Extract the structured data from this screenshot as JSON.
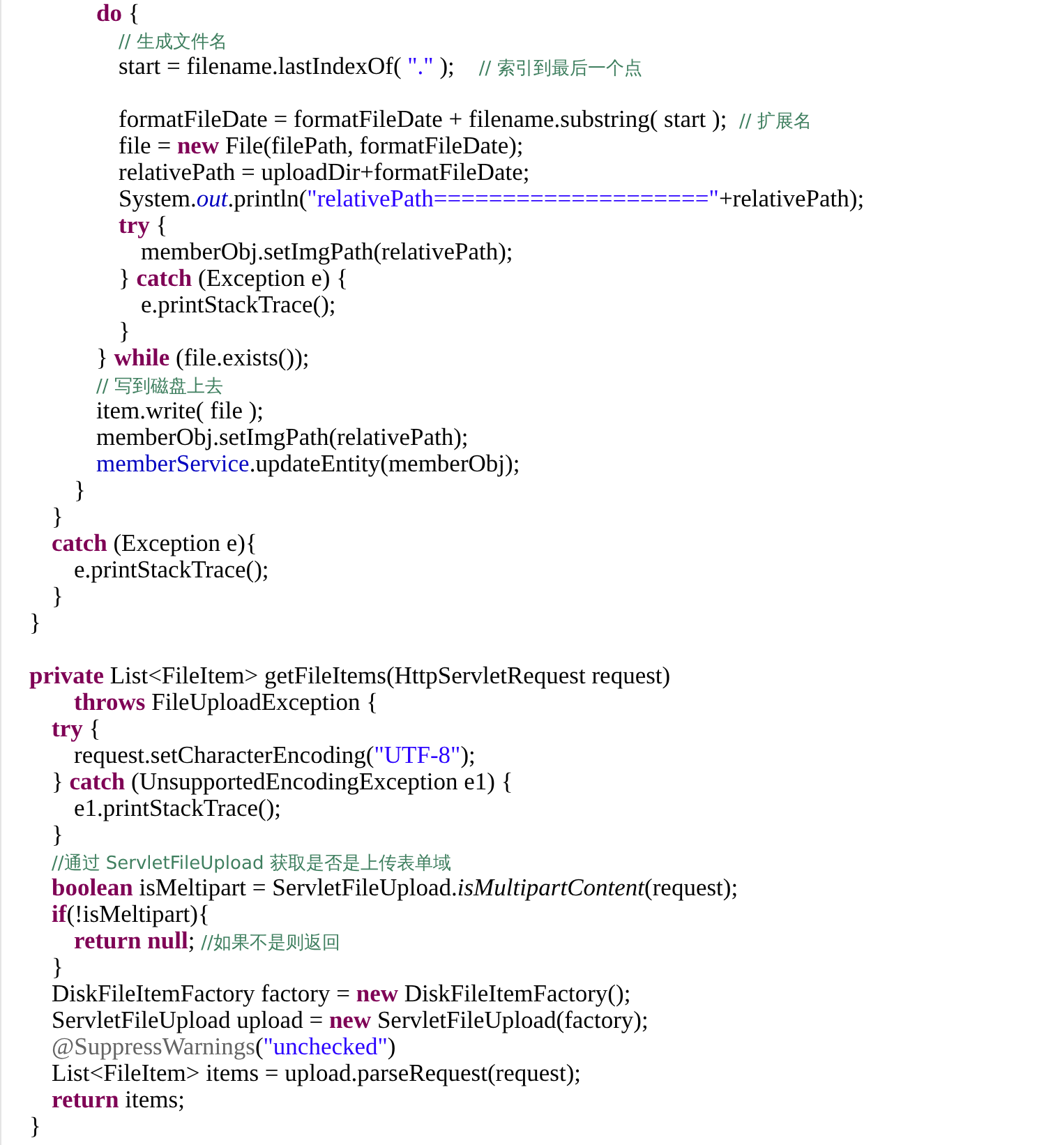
{
  "code_lines": [
    {
      "kind": "code",
      "segments": [
        {
          "kind": "keyword",
          "text": "\t\t\tdo"
        },
        {
          "kind": "plain",
          "text": " {"
        }
      ]
    },
    {
      "kind": "code",
      "segments": [
        {
          "kind": "comment",
          "text": "\t\t\t\t// 生成文件名"
        }
      ]
    },
    {
      "kind": "code",
      "segments": [
        {
          "kind": "plain",
          "text": "\t\t\t\tstart = filename.lastIndexOf( "
        },
        {
          "kind": "string",
          "text": "\".\""
        },
        {
          "kind": "plain",
          "text": " );    "
        },
        {
          "kind": "comment",
          "text": "// 索引到最后一个点"
        }
      ]
    },
    {
      "kind": "blank"
    },
    {
      "kind": "code",
      "segments": [
        {
          "kind": "plain",
          "text": "\t\t\t\tformatFileDate = formatFileDate + filename.substring( start );  "
        },
        {
          "kind": "comment",
          "text": "// 扩展名"
        }
      ]
    },
    {
      "kind": "code",
      "segments": [
        {
          "kind": "plain",
          "text": "\t\t\t\tfile = "
        },
        {
          "kind": "keyword",
          "text": "new"
        },
        {
          "kind": "plain",
          "text": " File(filePath, formatFileDate);"
        }
      ]
    },
    {
      "kind": "code",
      "segments": [
        {
          "kind": "plain",
          "text": "\t\t\t\trelativePath = uploadDir+formatFileDate;"
        }
      ]
    },
    {
      "kind": "code",
      "segments": [
        {
          "kind": "plain",
          "text": "\t\t\t\tSystem."
        },
        {
          "kind": "static_field",
          "text": "out"
        },
        {
          "kind": "plain",
          "text": ".println("
        },
        {
          "kind": "string",
          "text": "\"relativePath====================\""
        },
        {
          "kind": "plain",
          "text": "+relativePath);"
        }
      ]
    },
    {
      "kind": "code",
      "segments": [
        {
          "kind": "keyword",
          "text": "\t\t\t\ttry"
        },
        {
          "kind": "plain",
          "text": " {"
        }
      ]
    },
    {
      "kind": "code",
      "segments": [
        {
          "kind": "plain",
          "text": "\t\t\t\t\tmemberObj.setImgPath(relativePath);"
        }
      ]
    },
    {
      "kind": "code",
      "segments": [
        {
          "kind": "plain",
          "text": "\t\t\t\t} "
        },
        {
          "kind": "keyword",
          "text": "catch"
        },
        {
          "kind": "plain",
          "text": " (Exception e) {"
        }
      ]
    },
    {
      "kind": "code",
      "segments": [
        {
          "kind": "plain",
          "text": "\t\t\t\t\te.printStackTrace();"
        }
      ]
    },
    {
      "kind": "code",
      "segments": [
        {
          "kind": "plain",
          "text": "\t\t\t\t}"
        }
      ]
    },
    {
      "kind": "code",
      "segments": [
        {
          "kind": "plain",
          "text": "\t\t\t} "
        },
        {
          "kind": "keyword",
          "text": "while"
        },
        {
          "kind": "plain",
          "text": " (file.exists());"
        }
      ]
    },
    {
      "kind": "code",
      "segments": [
        {
          "kind": "comment",
          "text": "\t\t\t// 写到磁盘上去"
        }
      ]
    },
    {
      "kind": "code",
      "segments": [
        {
          "kind": "plain",
          "text": "\t\t\titem.write( file );"
        }
      ]
    },
    {
      "kind": "code",
      "segments": [
        {
          "kind": "plain",
          "text": "\t\t\tmemberObj.setImgPath(relativePath);"
        }
      ]
    },
    {
      "kind": "code",
      "segments": [
        {
          "kind": "field",
          "text": "\t\t\tmemberService"
        },
        {
          "kind": "plain",
          "text": ".updateEntity(memberObj);"
        }
      ]
    },
    {
      "kind": "code",
      "segments": [
        {
          "kind": "plain",
          "text": "\t\t}"
        }
      ]
    },
    {
      "kind": "code",
      "segments": [
        {
          "kind": "plain",
          "text": "\t}"
        }
      ]
    },
    {
      "kind": "code",
      "segments": [
        {
          "kind": "keyword",
          "text": "\tcatch"
        },
        {
          "kind": "plain",
          "text": " (Exception e){"
        }
      ]
    },
    {
      "kind": "code",
      "segments": [
        {
          "kind": "plain",
          "text": "\t\te.printStackTrace();"
        }
      ]
    },
    {
      "kind": "code",
      "segments": [
        {
          "kind": "plain",
          "text": "\t}"
        }
      ]
    },
    {
      "kind": "code",
      "segments": [
        {
          "kind": "plain",
          "text": "}"
        }
      ]
    },
    {
      "kind": "blank"
    },
    {
      "kind": "code",
      "segments": [
        {
          "kind": "keyword",
          "text": "private"
        },
        {
          "kind": "plain",
          "text": " List<FileItem> getFileItems(HttpServletRequest request)"
        }
      ]
    },
    {
      "kind": "code",
      "segments": [
        {
          "kind": "keyword",
          "text": "\t\tthrows"
        },
        {
          "kind": "plain",
          "text": " FileUploadException {"
        }
      ]
    },
    {
      "kind": "code",
      "segments": [
        {
          "kind": "keyword",
          "text": "\ttry"
        },
        {
          "kind": "plain",
          "text": " {"
        }
      ]
    },
    {
      "kind": "code",
      "segments": [
        {
          "kind": "plain",
          "text": "\t\trequest.setCharacterEncoding("
        },
        {
          "kind": "string",
          "text": "\"UTF-8\""
        },
        {
          "kind": "plain",
          "text": ");"
        }
      ]
    },
    {
      "kind": "code",
      "segments": [
        {
          "kind": "plain",
          "text": "\t} "
        },
        {
          "kind": "keyword",
          "text": "catch"
        },
        {
          "kind": "plain",
          "text": " (UnsupportedEncodingException e1) {"
        }
      ]
    },
    {
      "kind": "code",
      "segments": [
        {
          "kind": "plain",
          "text": "\t\te1.printStackTrace();"
        }
      ]
    },
    {
      "kind": "code",
      "segments": [
        {
          "kind": "plain",
          "text": "\t}"
        }
      ]
    },
    {
      "kind": "code",
      "segments": [
        {
          "kind": "comment",
          "text": "\t//通过 ServletFileUpload 获取是否是上传表单域"
        }
      ]
    },
    {
      "kind": "code",
      "segments": [
        {
          "kind": "keyword",
          "text": "\tboolean"
        },
        {
          "kind": "plain",
          "text": " isMeltipart = ServletFileUpload."
        },
        {
          "kind": "static_method",
          "text": "isMultipartContent"
        },
        {
          "kind": "plain",
          "text": "(request);"
        }
      ]
    },
    {
      "kind": "code",
      "segments": [
        {
          "kind": "keyword",
          "text": "\tif"
        },
        {
          "kind": "plain",
          "text": "(!isMeltipart){"
        }
      ]
    },
    {
      "kind": "code",
      "segments": [
        {
          "kind": "keyword",
          "text": "\t\treturn null"
        },
        {
          "kind": "plain",
          "text": "; "
        },
        {
          "kind": "comment",
          "text": "//如果不是则返回"
        }
      ]
    },
    {
      "kind": "code",
      "segments": [
        {
          "kind": "plain",
          "text": "\t}"
        }
      ]
    },
    {
      "kind": "code",
      "segments": [
        {
          "kind": "plain",
          "text": "\tDiskFileItemFactory factory = "
        },
        {
          "kind": "keyword",
          "text": "new"
        },
        {
          "kind": "plain",
          "text": " DiskFileItemFactory();"
        }
      ]
    },
    {
      "kind": "code",
      "segments": [
        {
          "kind": "plain",
          "text": "\tServletFileUpload upload = "
        },
        {
          "kind": "keyword",
          "text": "new"
        },
        {
          "kind": "plain",
          "text": " ServletFileUpload(factory);"
        }
      ]
    },
    {
      "kind": "code",
      "segments": [
        {
          "kind": "annotation",
          "text": "\t@SuppressWarnings"
        },
        {
          "kind": "plain",
          "text": "("
        },
        {
          "kind": "string",
          "text": "\"unchecked\""
        },
        {
          "kind": "plain",
          "text": ")"
        }
      ]
    },
    {
      "kind": "code",
      "segments": [
        {
          "kind": "plain",
          "text": "\tList<FileItem> items = upload.parseRequest(request);"
        }
      ]
    },
    {
      "kind": "code",
      "segments": [
        {
          "kind": "keyword",
          "text": "\treturn"
        },
        {
          "kind": "plain",
          "text": " items;"
        }
      ]
    },
    {
      "kind": "code",
      "segments": [
        {
          "kind": "plain",
          "text": "}"
        }
      ]
    }
  ]
}
